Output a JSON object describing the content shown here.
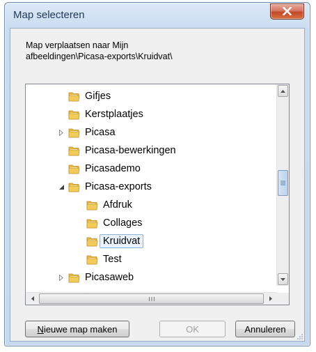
{
  "window": {
    "title": "Map selecteren",
    "close_icon": "close-icon"
  },
  "description": "Map verplaatsen naar Mijn\nafbeeldingen\\Picasa-exports\\Kruidvat\\",
  "tree": {
    "nodes": [
      {
        "label": "Gifjes",
        "depth": 1,
        "expander": "none",
        "selected": false
      },
      {
        "label": "Kerstplaatjes",
        "depth": 1,
        "expander": "none",
        "selected": false
      },
      {
        "label": "Picasa",
        "depth": 1,
        "expander": "collapsed",
        "selected": false
      },
      {
        "label": "Picasa-bewerkingen",
        "depth": 1,
        "expander": "none",
        "selected": false
      },
      {
        "label": "Picasademo",
        "depth": 1,
        "expander": "none",
        "selected": false
      },
      {
        "label": "Picasa-exports",
        "depth": 1,
        "expander": "expanded",
        "selected": false
      },
      {
        "label": "Afdruk",
        "depth": 2,
        "expander": "none",
        "selected": false
      },
      {
        "label": "Collages",
        "depth": 2,
        "expander": "none",
        "selected": false
      },
      {
        "label": "Kruidvat",
        "depth": 2,
        "expander": "none",
        "selected": true
      },
      {
        "label": "Test",
        "depth": 2,
        "expander": "none",
        "selected": false
      },
      {
        "label": "Picasaweb",
        "depth": 1,
        "expander": "collapsed",
        "selected": false
      }
    ],
    "folder_color": "#e8b93c",
    "selection_color": "#eaf3fd"
  },
  "buttons": {
    "new_folder": {
      "label": "Nieuwe map maken",
      "access_key": "N"
    },
    "ok": {
      "label": "OK",
      "enabled": false
    },
    "cancel": {
      "label": "Annuleren"
    }
  },
  "icons": {
    "up": "scroll-up-arrow-icon",
    "down": "scroll-down-arrow-icon",
    "left": "scroll-left-arrow-icon",
    "right": "scroll-right-arrow-icon",
    "folder": "folder-icon"
  }
}
